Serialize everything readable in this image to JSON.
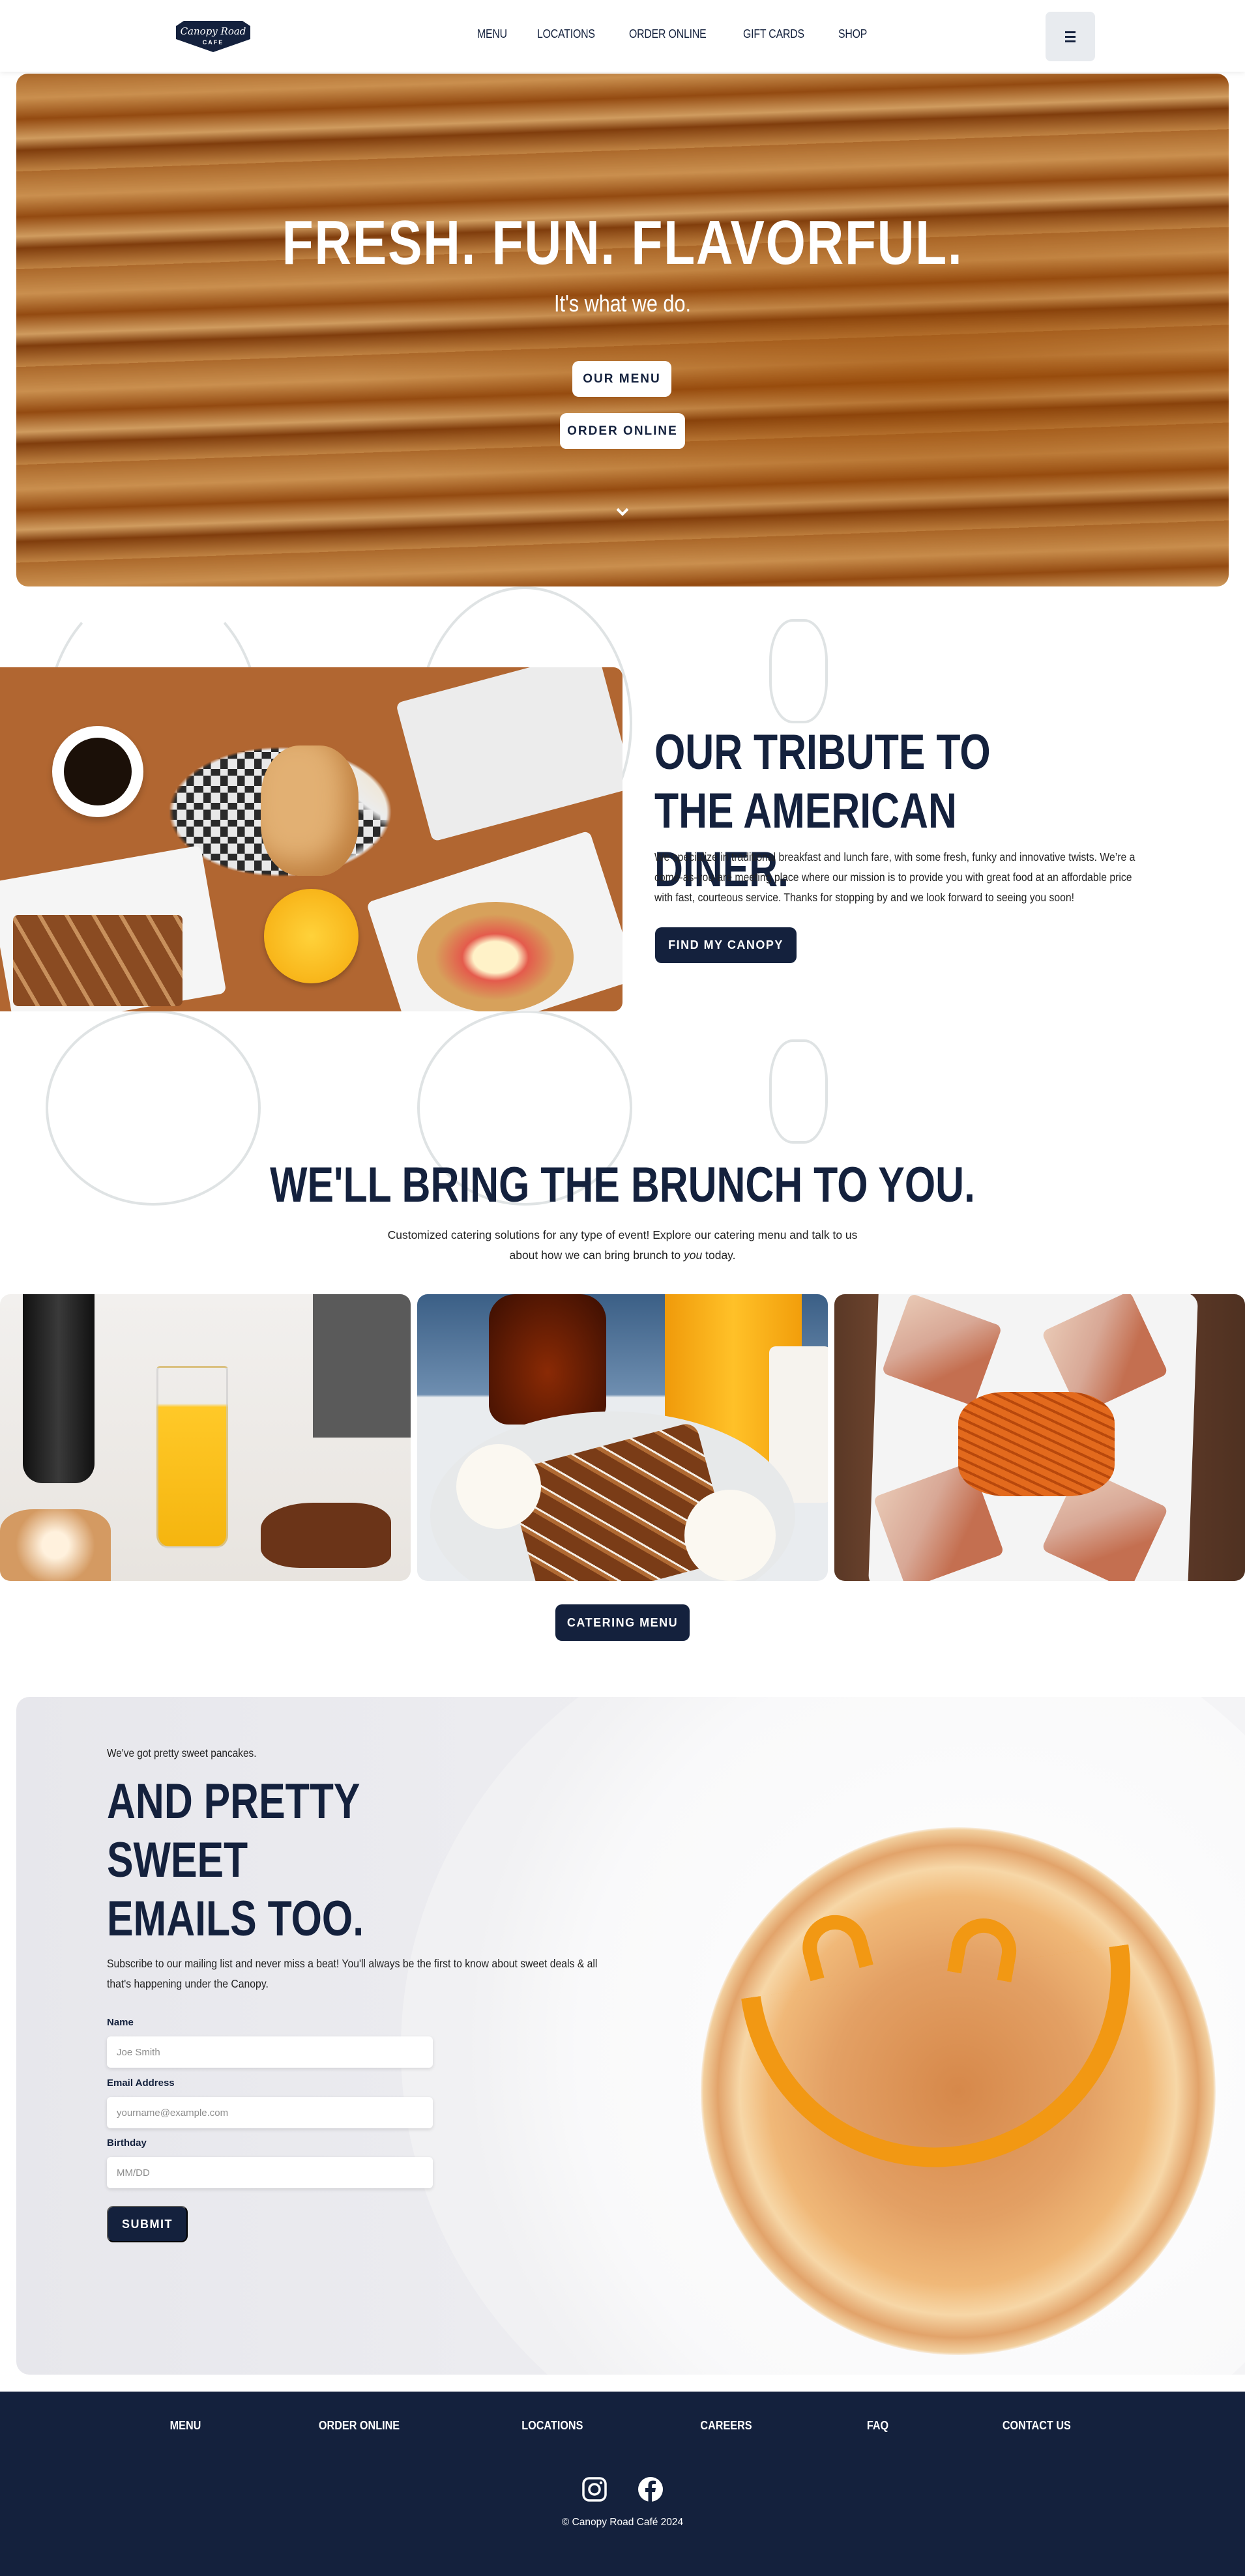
{
  "header": {
    "logo": {
      "line1": "Canopy Road",
      "line2": "CAFE"
    },
    "nav": [
      {
        "label": "MENU"
      },
      {
        "label": "LOCATIONS"
      },
      {
        "label": "ORDER ONLINE"
      },
      {
        "label": "GIFT CARDS"
      },
      {
        "label": "SHOP"
      }
    ],
    "menu_icon": "hamburger-icon"
  },
  "hero": {
    "title": "FRESH. FUN. FLAVORFUL.",
    "subtitle": "It's what we do.",
    "buttons": [
      {
        "label": "OUR MENU"
      },
      {
        "label": "ORDER ONLINE"
      }
    ],
    "scroll_icon": "chevron-down-icon"
  },
  "tribute": {
    "title": "OUR TRIBUTE TO THE AMERICAN DINER.",
    "body": "We specialize in traditional breakfast and lunch fare, with some fresh, funky and innovative twists. We’re a come-as-you-are meeting place where our mission is to provide you with great food at an affordable price with fast, courteous service. Thanks for stopping by and we look forward to seeing you soon!",
    "button": "FIND MY CANOPY"
  },
  "catering": {
    "title": "WE'LL BRING THE BRUNCH TO YOU.",
    "body_pre": "Customized catering solutions for any type of event! Explore our catering menu and talk to us about how we can bring brunch to ",
    "body_em": "you",
    "body_post": " today.",
    "images": [
      "mimosa-breakfast-photo",
      "waffle-plate-photo",
      "club-sandwich-fries-photo"
    ],
    "button": "CATERING MENU"
  },
  "newsletter": {
    "kicker": "We've got pretty sweet pancakes.",
    "title": "AND PRETTY SWEET EMAILS TOO.",
    "body": "Subscribe to our mailing list and never miss a beat! You'll always be the first to know about sweet deals & all that's happening under the Canopy.",
    "fields": [
      {
        "label": "Name",
        "placeholder": "Joe Smith",
        "value": ""
      },
      {
        "label": "Email Address",
        "placeholder": "yourname@example.com",
        "value": ""
      },
      {
        "label": "Birthday",
        "placeholder": "MM/DD",
        "value": ""
      }
    ],
    "submit": "SUBMIT"
  },
  "footer": {
    "links": [
      {
        "label": "MENU"
      },
      {
        "label": "ORDER ONLINE"
      },
      {
        "label": "LOCATIONS"
      },
      {
        "label": "CAREERS"
      },
      {
        "label": "FAQ"
      },
      {
        "label": "CONTACT US"
      }
    ],
    "social": [
      "instagram-icon",
      "facebook-icon"
    ],
    "copyright": "© Canopy Road Café 2024"
  },
  "colors": {
    "navy": "#14213d",
    "white": "#ffffff",
    "syrup_orange": "#f29813"
  }
}
